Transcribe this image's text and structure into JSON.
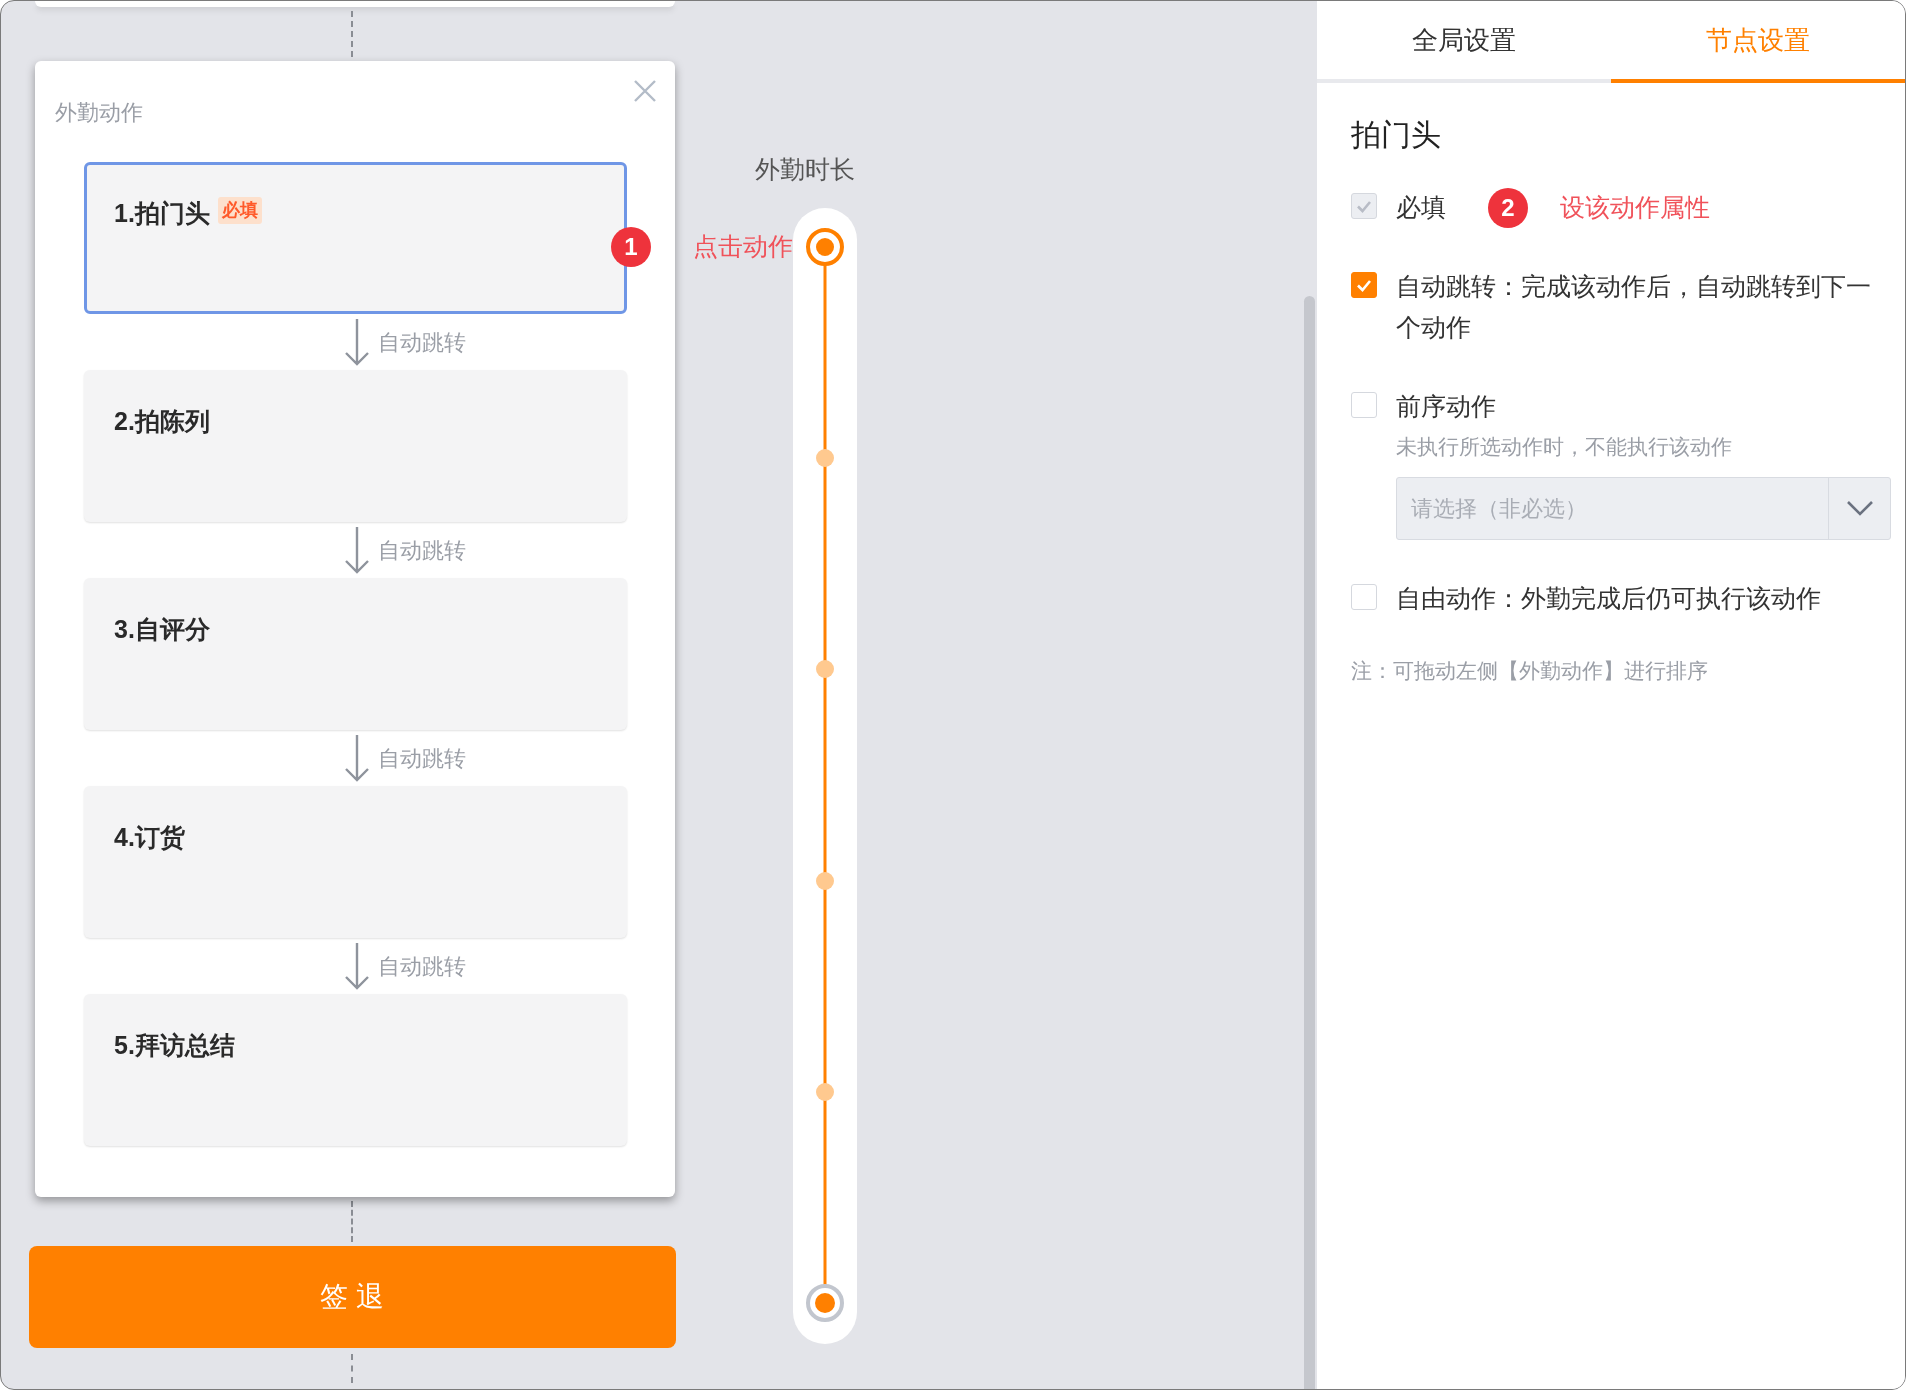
{
  "action_panel": {
    "title": "外勤动作",
    "actions": [
      {
        "title": "1.拍门头",
        "tag": "必填",
        "selected": true
      },
      {
        "title": "2.拍陈列",
        "selected": false
      },
      {
        "title": "3.自评分",
        "selected": false
      },
      {
        "title": "4.订货",
        "selected": false
      },
      {
        "title": "5.拜访总结",
        "selected": false
      }
    ],
    "connectors": [
      "自动跳转",
      "自动跳转",
      "自动跳转",
      "自动跳转"
    ]
  },
  "callout_1": {
    "number": "1",
    "text": "点击动作"
  },
  "timeline": {
    "title": "外勤时长"
  },
  "checkout_button": "签 退",
  "settings": {
    "tabs": [
      {
        "label": "全局设置",
        "selected": false
      },
      {
        "label": "节点设置",
        "selected": true
      }
    ],
    "node_title": "拍门头",
    "options": [
      {
        "label": "必填",
        "checked": true,
        "disabled": true,
        "callout": {
          "number": "2",
          "text": "设该动作属性"
        }
      },
      {
        "label": "自动跳转：完成该动作后，自动跳转到下一个动作",
        "checked": true,
        "disabled": false
      },
      {
        "label": "前序动作",
        "checked": false,
        "disabled": false,
        "hint": "未执行所选动作时，不能执行该动作",
        "select": {
          "placeholder": "请选择（非必选）"
        }
      },
      {
        "label": "自由动作：外勤完成后仍可执行该动作",
        "checked": false,
        "disabled": false
      }
    ],
    "note": "注：可拖动左侧【外勤动作】进行排序"
  }
}
